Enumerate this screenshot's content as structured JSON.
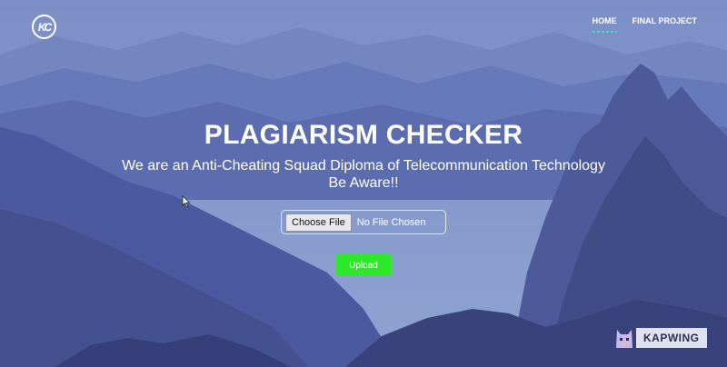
{
  "logo": {
    "text": "KC"
  },
  "nav": {
    "items": [
      {
        "label": "HOME",
        "active": true
      },
      {
        "label": "FINAL PROJECT",
        "active": false
      }
    ]
  },
  "hero": {
    "title": "PLAGIARISM CHECKER",
    "subtitle_line1": "We are an Anti-Cheating Squad Diploma of Telecommunication Technology",
    "subtitle_line2": "Be Aware!!"
  },
  "upload_form": {
    "choose_file_label": "Choose File",
    "file_status": "No File Chosen",
    "upload_label": "Upload"
  },
  "watermark": {
    "text": "KAPWING"
  },
  "colors": {
    "overlay": "#5a6bb0",
    "upload_button": "#2ee82a",
    "nav_underline": "#3ee0c8"
  }
}
